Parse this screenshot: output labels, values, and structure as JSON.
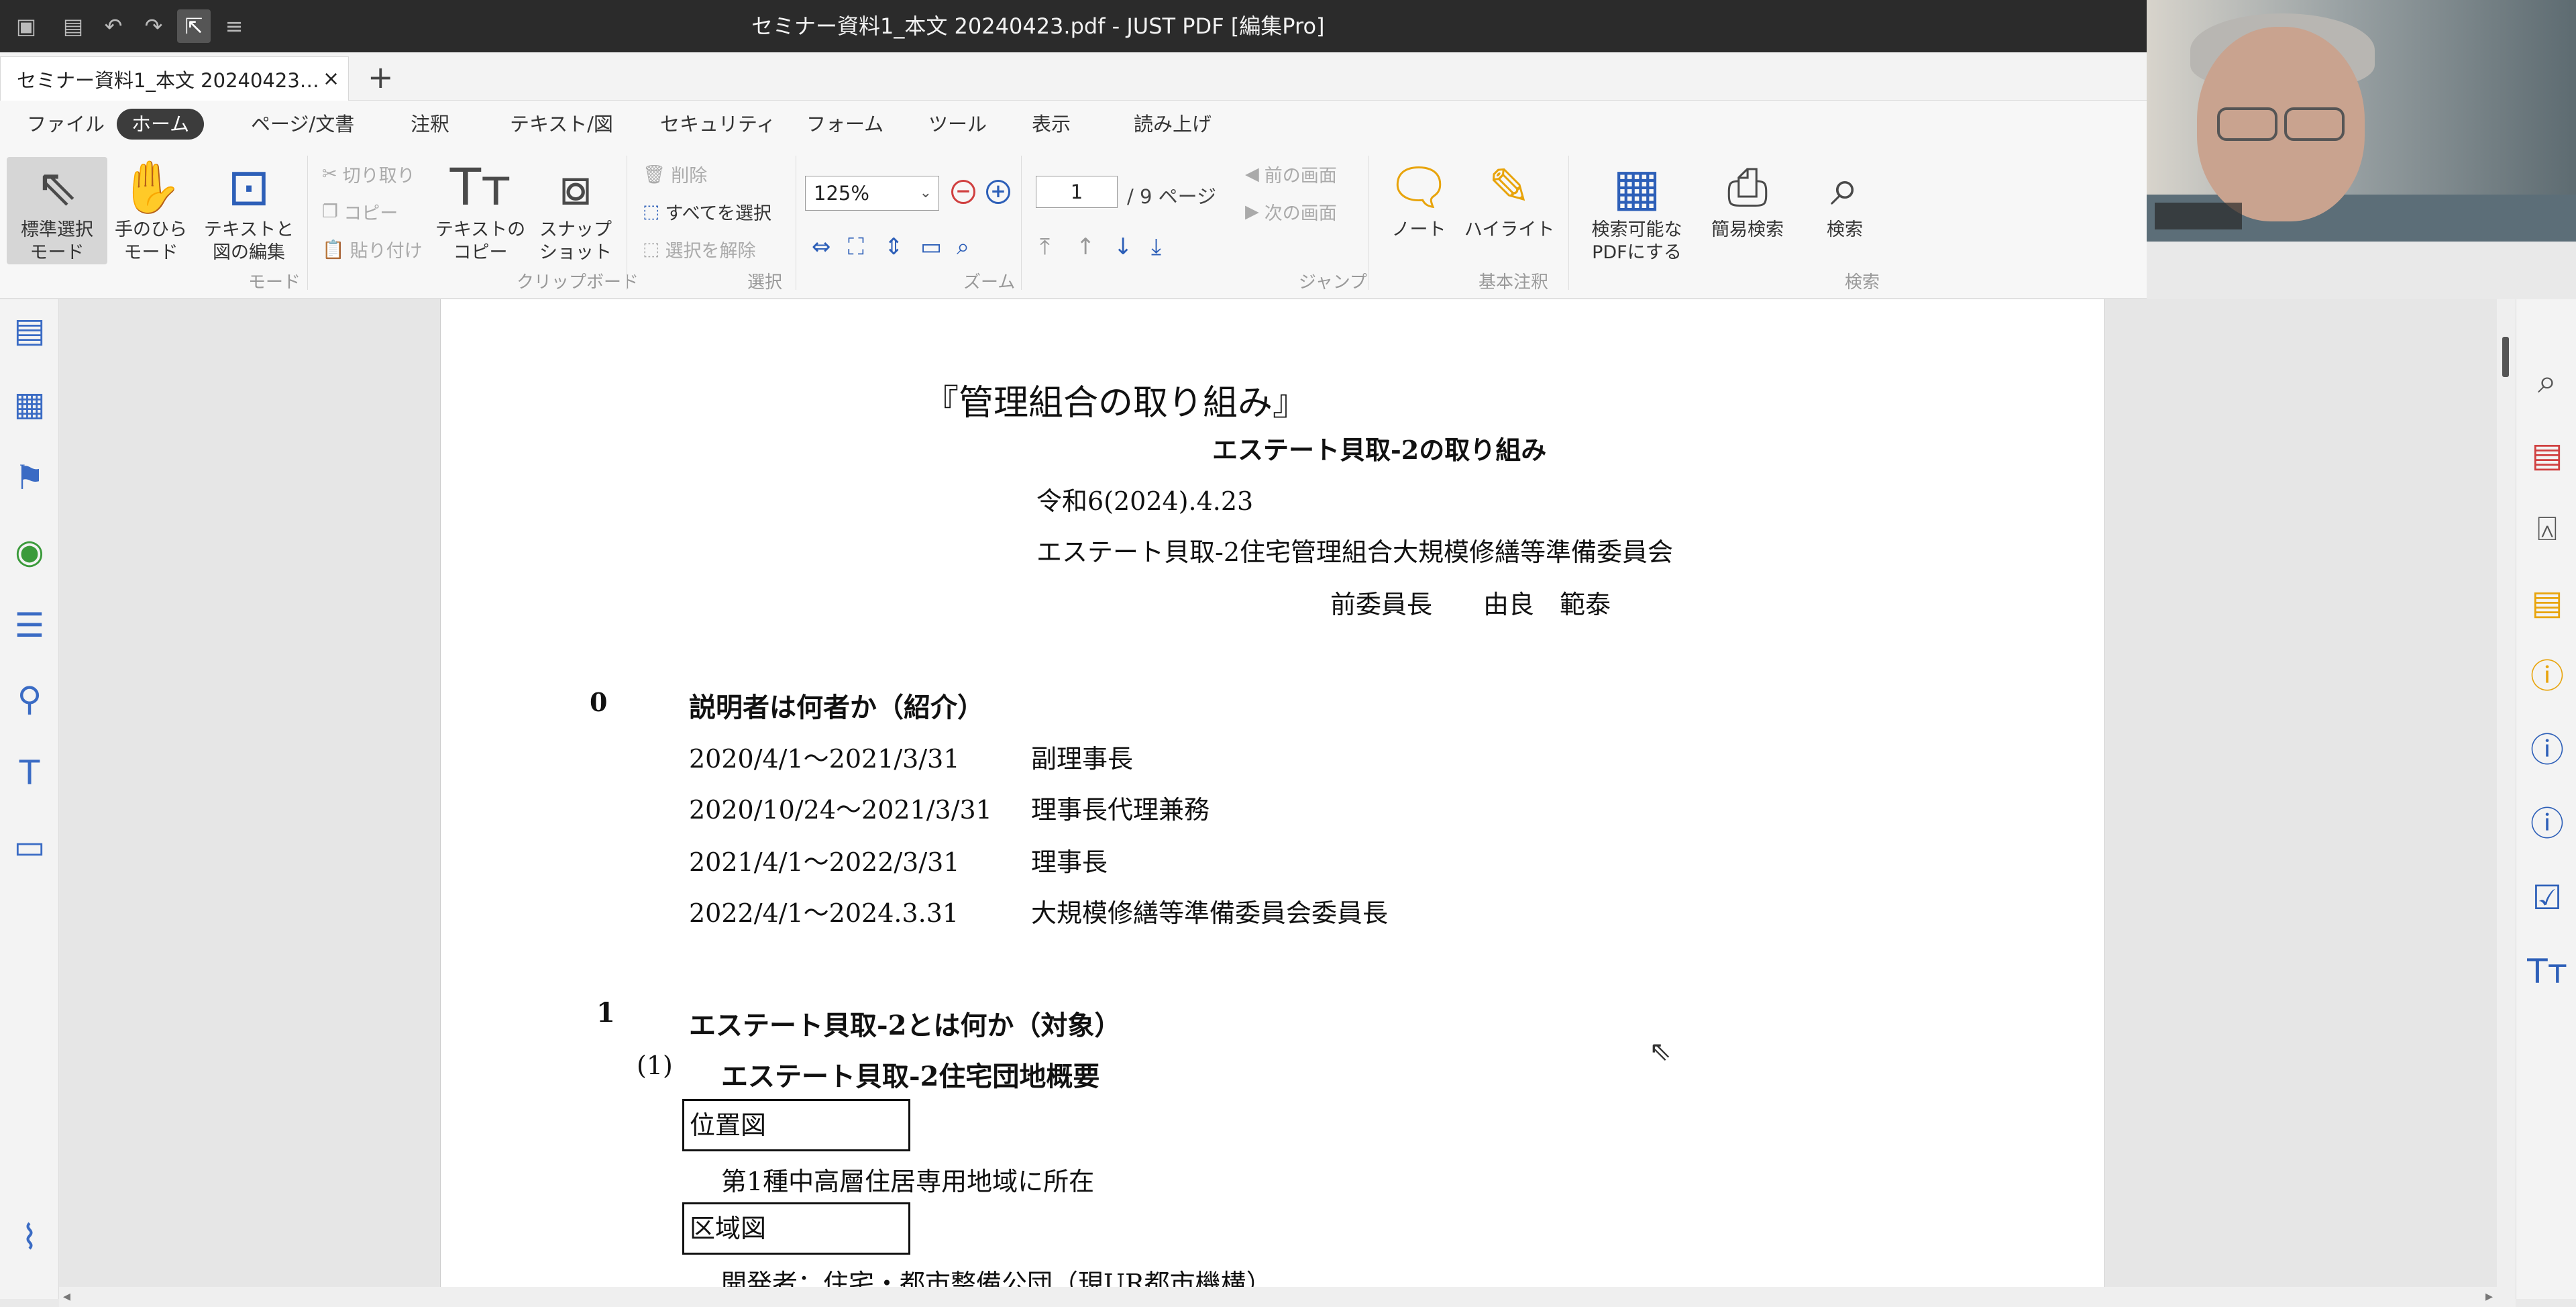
{
  "window": {
    "title": "セミナー資料1_本文  20240423.pdf - JUST PDF [編集Pro]"
  },
  "tab": {
    "label": "セミナー資料1_本文  20240423…",
    "close": "×",
    "new": "+"
  },
  "menu": [
    "ファイル",
    "ホーム",
    "ページ/文書",
    "注釈",
    "テキスト/図",
    "セキュリティ",
    "フォーム",
    "ツール",
    "表示",
    "読み上げ"
  ],
  "ribbon": {
    "mode": {
      "select_l1": "標準選択",
      "select_l2": "モード",
      "hand_l1": "手のひら",
      "hand_l2": "モード",
      "edit_l1": "テキストと",
      "edit_l2": "図の編集",
      "label": "モード"
    },
    "clipboard": {
      "cut": "切り取り",
      "copy": "コピー",
      "paste": "貼り付け",
      "textcopy_l1": "テキストの",
      "textcopy_l2": "コピー",
      "snap_l1": "スナップ",
      "snap_l2": "ショット",
      "label": "クリップボード"
    },
    "select": {
      "delete": "削除",
      "select_all": "すべてを選択",
      "deselect": "選択を解除",
      "label": "選択"
    },
    "zoom": {
      "value": "125%",
      "label": "ズーム"
    },
    "jump": {
      "page": "1",
      "total": "/ 9 ページ",
      "prev": "前の画面",
      "next": "次の画面",
      "label": "ジャンプ"
    },
    "annot": {
      "note": "ノート",
      "highlight": "ハイライト",
      "label": "基本注釈"
    },
    "search": {
      "ocr_l1": "検索可能な",
      "ocr_l2": "PDFにする",
      "simple": "簡易検索",
      "search": "検索",
      "label": "検索"
    }
  },
  "doc": {
    "title": "『管理組合の取り組み』",
    "subtitle": "エステート貝取-2の取り組み",
    "date": "令和6(2024).4.23",
    "org": "エステート貝取-2住宅管理組合大規模修繕等準備委員会",
    "author": "前委員長　　由良　範泰",
    "s0_num": "0",
    "s0_title": "説明者は何者か（紹介）",
    "history": [
      {
        "period": "2020/4/1～2021/3/31",
        "role": "副理事長"
      },
      {
        "period": "2020/10/24～2021/3/31",
        "role": "理事長代理兼務"
      },
      {
        "period": "2021/4/1～2022/3/31",
        "role": "理事長"
      },
      {
        "period": "2022/4/1～2024.3.31",
        "role": "大規模修繕等準備委員会委員長"
      }
    ],
    "s1_num": "1",
    "s1_title": "エステート貝取-2とは何か（対象）",
    "s1_1_num": "(1)",
    "s1_1_title": "エステート貝取-2住宅団地概要",
    "box1": "位置図",
    "box1_text": "第1種中高層住居専用地域に所在",
    "box2": "区域図",
    "box2_text": "開発者：住宅・都市整備公団（現UR都市機構）"
  }
}
